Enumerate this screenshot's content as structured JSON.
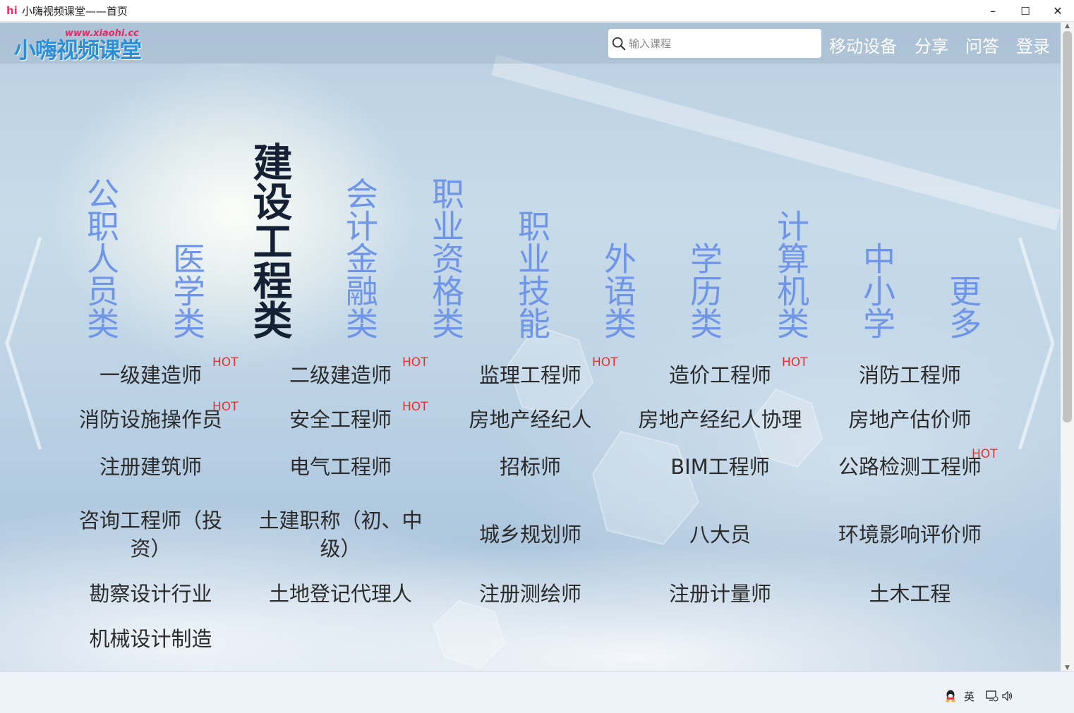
{
  "window": {
    "app_icon": "hi",
    "title": "小嗨视频课堂——首页",
    "minimize_glyph": "–",
    "maximize_glyph": "☐",
    "close_glyph": "✕"
  },
  "header": {
    "logo_text": "小嗨视频课堂",
    "logo_url": "www.xiaohi.cc",
    "search_placeholder": "输入课程",
    "nav": [
      "移动设备",
      "分享",
      "问答",
      "登录"
    ]
  },
  "categories": [
    {
      "label": "公职人员类",
      "active": false
    },
    {
      "label": "医学类",
      "active": false
    },
    {
      "label": "建设工程类",
      "active": true
    },
    {
      "label": "会计金融类",
      "active": false
    },
    {
      "label": "职业资格类",
      "active": false
    },
    {
      "label": "职业技能",
      "active": false
    },
    {
      "label": "外语类",
      "active": false
    },
    {
      "label": "学历类",
      "active": false
    },
    {
      "label": "计算机类",
      "active": false
    },
    {
      "label": "中小学",
      "active": false
    },
    {
      "label": "更多",
      "active": false
    }
  ],
  "courses": [
    {
      "name": "一级建造师",
      "hot": true
    },
    {
      "name": "二级建造师",
      "hot": true
    },
    {
      "name": "监理工程师",
      "hot": true
    },
    {
      "name": "造价工程师",
      "hot": true
    },
    {
      "name": "消防工程师",
      "hot": false
    },
    {
      "name": "消防设施操作员",
      "hot": true
    },
    {
      "name": "安全工程师",
      "hot": true
    },
    {
      "name": "房地产经纪人",
      "hot": false
    },
    {
      "name": "房地产经纪人协理",
      "hot": false
    },
    {
      "name": "房地产估价师",
      "hot": false
    },
    {
      "name": "注册建筑师",
      "hot": false
    },
    {
      "name": "电气工程师",
      "hot": false
    },
    {
      "name": "招标师",
      "hot": false
    },
    {
      "name": "BIM工程师",
      "hot": false
    },
    {
      "name": "公路检测工程师",
      "hot": true
    },
    {
      "name": "咨询工程师（投资）",
      "hot": false
    },
    {
      "name": "土建职称（初、中级）",
      "hot": false
    },
    {
      "name": "城乡规划师",
      "hot": false
    },
    {
      "name": "八大员",
      "hot": false
    },
    {
      "name": "环境影响评价师",
      "hot": false
    },
    {
      "name": "勘察设计行业",
      "hot": false
    },
    {
      "name": "土地登记代理人",
      "hot": false
    },
    {
      "name": "注册测绘师",
      "hot": false
    },
    {
      "name": "注册计量师",
      "hot": false
    },
    {
      "name": "土木工程",
      "hot": false
    },
    {
      "name": "机械设计制造",
      "hot": false
    }
  ],
  "hot_label": "HOT",
  "taskbar": {
    "ime_label": "英"
  },
  "icons": {
    "search": "search-icon",
    "prev": "chevron-left-icon",
    "next": "chevron-right-icon",
    "qq": "qq-icon",
    "network": "network-icon",
    "volume": "volume-icon"
  },
  "colors": {
    "category_inactive": "#6f95e8",
    "category_active": "#142033",
    "hot": "#e83030",
    "logo": "#2a8fd6",
    "logo_url": "#e02a66"
  }
}
